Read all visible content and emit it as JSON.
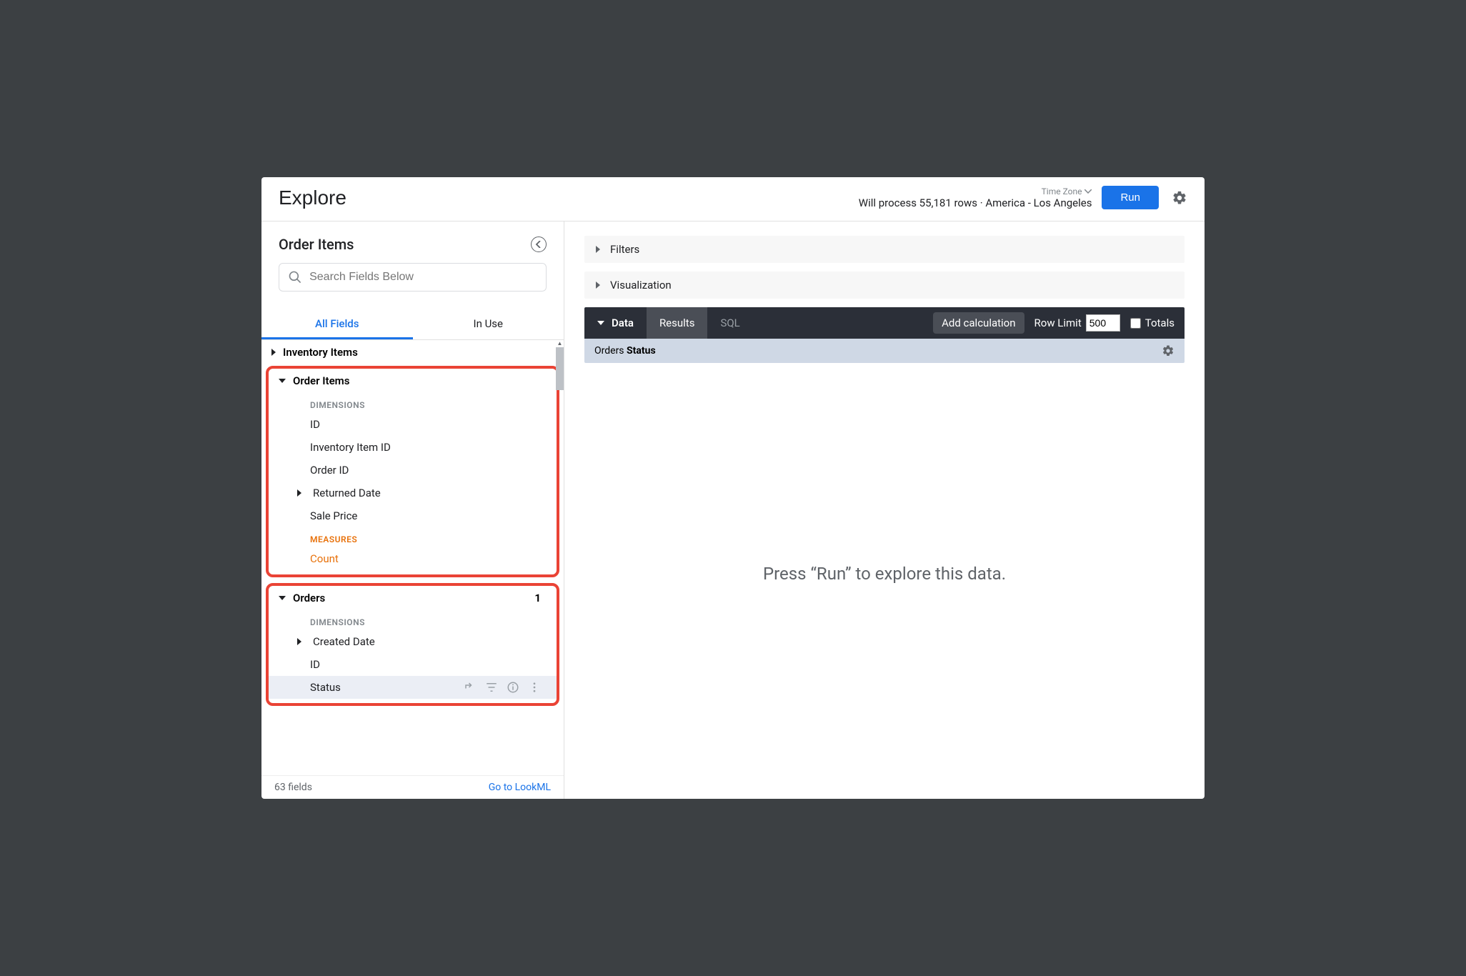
{
  "header": {
    "title": "Explore",
    "timezone_label": "Time Zone",
    "rowcount_text": "Will process 55,181 rows · America - Los Angeles",
    "run_label": "Run"
  },
  "sidebar": {
    "title": "Order Items",
    "search_placeholder": "Search Fields Below",
    "tabs": {
      "all": "All Fields",
      "inuse": "In Use"
    },
    "groups": {
      "inventory": {
        "label": "Inventory Items"
      },
      "order_items": {
        "label": "Order Items",
        "dimensions_label": "DIMENSIONS",
        "measures_label": "MEASURES",
        "dimensions": {
          "id": "ID",
          "inventory_item_id": "Inventory Item ID",
          "order_id": "Order ID",
          "returned_date": "Returned Date",
          "sale_price": "Sale Price"
        },
        "measures": {
          "count": "Count"
        }
      },
      "orders": {
        "label": "Orders",
        "badge": "1",
        "dimensions_label": "DIMENSIONS",
        "dimensions": {
          "created_date": "Created Date",
          "id": "ID",
          "status": "Status"
        }
      }
    },
    "footer": {
      "count": "63 fields",
      "link": "Go to LookML"
    }
  },
  "main": {
    "filters_label": "Filters",
    "visualization_label": "Visualization",
    "databar": {
      "data": "Data",
      "results": "Results",
      "sql": "SQL",
      "add_calc": "Add calculation",
      "row_limit_label": "Row Limit",
      "row_limit_value": "500",
      "totals_label": "Totals"
    },
    "column_header_prefix": "Orders ",
    "column_header_bold": "Status",
    "placeholder": "Press “Run” to explore this data."
  }
}
